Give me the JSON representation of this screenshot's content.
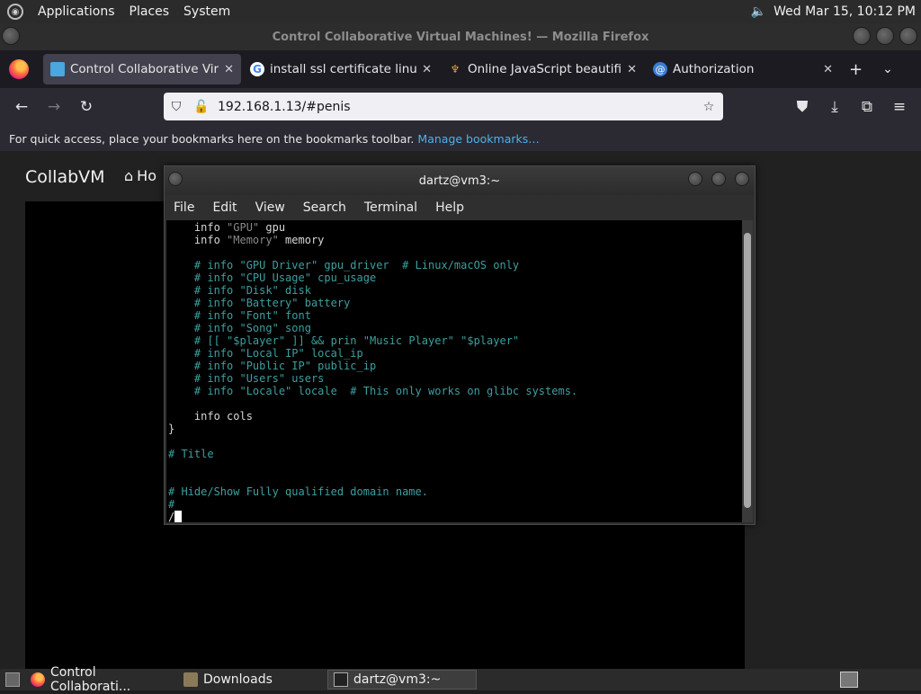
{
  "top_panel": {
    "menus": [
      "Applications",
      "Places",
      "System"
    ],
    "clock": "Wed Mar 15, 10:12 PM"
  },
  "firefox": {
    "window_title": "Control Collaborative Virtual Machines! — Mozilla Firefox",
    "tabs": [
      {
        "label": "Control Collaborative Virtua",
        "active": true
      },
      {
        "label": "install ssl certificate linux - G",
        "active": false
      },
      {
        "label": "Online JavaScript beautifier",
        "active": false
      },
      {
        "label": "Authorization",
        "active": false
      }
    ],
    "url": "192.168.1.13/#penis",
    "bookmarks_hint": "For quick access, place your bookmarks here on the bookmarks toolbar.",
    "manage_bookmarks": "Manage bookmarks…"
  },
  "page": {
    "brand": "CollabVM",
    "home_partial": "Ho"
  },
  "terminal": {
    "title": "dartz@vm3:~",
    "menu": [
      "File",
      "Edit",
      "View",
      "Search",
      "Terminal",
      "Help"
    ]
  },
  "taskbar": {
    "items": [
      "Control Collaborati...",
      "Downloads",
      "dartz@vm3:~"
    ]
  },
  "colors": {
    "firefox_tabbar": "#1c1b22",
    "firefox_toolbar": "#2b2a33",
    "link": "#4fb0e8",
    "terminal_comment": "#3e9f9f"
  }
}
